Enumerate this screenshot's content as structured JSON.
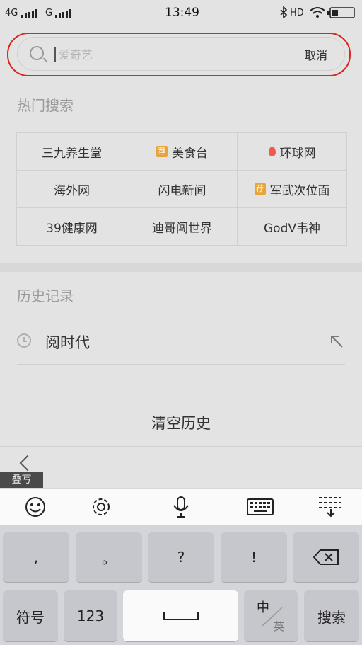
{
  "status_bar": {
    "network_1": "4G",
    "network_2": "G",
    "time": "13:49",
    "hd": "HD"
  },
  "search": {
    "placeholder": "爱奇艺",
    "cancel_label": "取消"
  },
  "hot_search": {
    "title": "热门搜索",
    "items": [
      {
        "label": "三九养生堂",
        "icon": ""
      },
      {
        "label": "美食台",
        "icon": "recommend-badge",
        "badge_text": "荐"
      },
      {
        "label": "环球网",
        "icon": "fire-icon"
      },
      {
        "label": "海外网",
        "icon": ""
      },
      {
        "label": "闪电新闻",
        "icon": ""
      },
      {
        "label": "军武次位面",
        "icon": "recommend-badge",
        "badge_text": "荐"
      },
      {
        "label": "39健康网",
        "icon": ""
      },
      {
        "label": "迪哥闯世界",
        "icon": ""
      },
      {
        "label": "GodV韦神",
        "icon": ""
      }
    ]
  },
  "history": {
    "title": "历史记录",
    "items": [
      {
        "label": "阅时代"
      }
    ],
    "clear_label": "清空历史"
  },
  "overlay_label": "叠写",
  "keyboard": {
    "toolbar": [
      "emoji-icon",
      "settings-icon",
      "microphone-icon",
      "keyboard-icon",
      "collapse-keyboard-icon"
    ],
    "row1": [
      ",",
      "。",
      "?",
      "!"
    ],
    "row2": {
      "symbols": "符号",
      "numbers": "123",
      "lang_top": "中",
      "lang_bottom": "英",
      "search": "搜索"
    }
  },
  "colors": {
    "background": "#e3e3e3",
    "annotation_red": "#d9271f",
    "badge_orange": "#e8a33a",
    "fire_red": "#ef5a4a"
  }
}
